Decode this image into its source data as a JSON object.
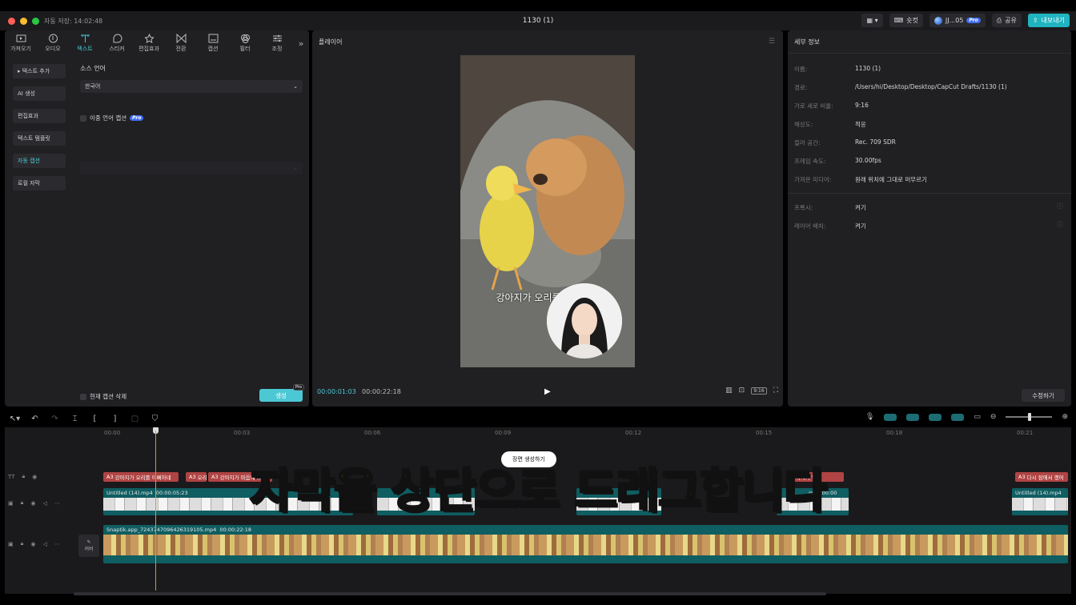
{
  "window": {
    "autosave": "자동 저장: 14:02:48",
    "title": "1130 (1)",
    "shortcut_label": "숏컷",
    "user_label": "JJ...05",
    "pro_badge": "Pro",
    "share_label": "공유",
    "export_label": "내보내기"
  },
  "toolbar": {
    "tools": [
      "가져오기",
      "오디오",
      "텍스트",
      "스티커",
      "편집효과",
      "전환",
      "캡션",
      "필터",
      "조정"
    ],
    "active_index": 2
  },
  "sidebar": {
    "items": [
      "▸ 텍스트 추가",
      "AI 생성",
      "편집효과",
      "텍스트 템플릿",
      "자동 캡션",
      "로컬 자막"
    ],
    "active_index": 4
  },
  "caption_panel": {
    "source_lang_label": "소스 언어",
    "source_lang_value": "한국어",
    "bilingual_label": "이중 언어 캡션",
    "bilingual_pro": "Pro",
    "delete_current_label": "현재 캡션 삭제",
    "generate_label": "생성",
    "generate_pro": "Pro"
  },
  "player": {
    "title": "플레이어",
    "overlay_caption": "강아지가 오리를 이뻐하네",
    "current_time": "00:00:01:03",
    "total_time": "00:00:22:18",
    "ratio_label": "9:16"
  },
  "details": {
    "title": "세부 정보",
    "rows": [
      {
        "key": "이름:",
        "value": "1130 (1)"
      },
      {
        "key": "경로:",
        "value": "/Users/hi/Desktop/Desktop/CapCut Drafts/1130 (1)"
      },
      {
        "key": "가로 세로 비율:",
        "value": "9:16"
      },
      {
        "key": "해상도:",
        "value": "적응"
      },
      {
        "key": "컬러 공간:",
        "value": "Rec. 709 SDR"
      },
      {
        "key": "프레임 속도:",
        "value": "30.00fps"
      },
      {
        "key": "가져온 미디어:",
        "value": "원래 위치에 그대로 머무르기"
      }
    ],
    "rows2": [
      {
        "key": "프록시:",
        "value": "켜기"
      },
      {
        "key": "레이어 배치:",
        "value": "켜기"
      }
    ],
    "edit_label": "수정하기"
  },
  "timeline": {
    "ruler": [
      "00:00",
      "00:03",
      "00:06",
      "00:09",
      "00:12",
      "00:15",
      "00:18",
      "00:21"
    ],
    "caption_clips": [
      "강아지가 오리를 이뻐하네",
      "오리",
      "강아지가 마음에 드",
      "강아지가 멀어",
      "다시 잠에서 깼어"
    ],
    "caption_clip_prefix": "A3",
    "video_clip_name": "Untitled (14).mp4",
    "video_clip_duration": "00:00:05:23",
    "video_clip_short": "mp4  00:00",
    "main_clip_name": "Snaptik.app_7243747096426319105.mp4",
    "main_clip_duration": "00:00:22:18",
    "cover_label": "커버",
    "tooltip": "장면 생성하기"
  },
  "overlay_subtitle": "자막을 상단으로 드래그합니다",
  "colors": {
    "accent": "#4cc8d4",
    "caption_clip": "#b04343",
    "video_clip": "#0f5e62",
    "subtitle_fill": "#f4ef2a"
  }
}
